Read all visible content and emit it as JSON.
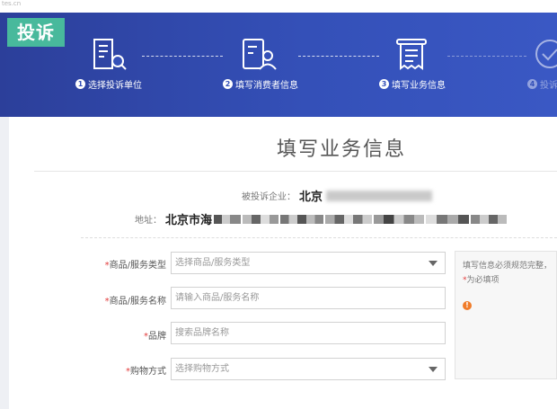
{
  "watermark": "tes.cn",
  "banner": {
    "tag": "投诉",
    "steps": [
      {
        "num": "1",
        "label": "选择投诉单位",
        "icon": "building-search-icon"
      },
      {
        "num": "2",
        "label": "填写消费者信息",
        "icon": "user-form-icon"
      },
      {
        "num": "3",
        "label": "填写业务信息",
        "icon": "receipt-icon"
      },
      {
        "num": "4",
        "label": "投诉",
        "icon": "check-circle-icon"
      }
    ]
  },
  "page_title": "填写业务信息",
  "complaint_target": {
    "label": "被投诉企业：",
    "value": "北京"
  },
  "address": {
    "label": "地址：",
    "value": "北京市海"
  },
  "form": {
    "fields": [
      {
        "required": "*",
        "label": "商品/服务类型",
        "placeholder": "选择商品/服务类型",
        "type": "select"
      },
      {
        "required": "*",
        "label": "商品/服务名称",
        "placeholder": "请输入商品/服务名称",
        "type": "input"
      },
      {
        "required": "*",
        "label": "品牌",
        "placeholder": "搜索品牌名称",
        "type": "input"
      },
      {
        "required": "*",
        "label": "购物方式",
        "placeholder": "选择购物方式",
        "type": "select"
      }
    ]
  },
  "tip": {
    "line1": "填写信息必须规范完整，",
    "line2_star": "*",
    "line2_text": "为必填项",
    "warn_symbol": "!"
  },
  "colors": {
    "banner": "#3450b8",
    "tag_bg": "#48b99c",
    "required": "#e23b3b",
    "warn": "#f07c2a"
  }
}
